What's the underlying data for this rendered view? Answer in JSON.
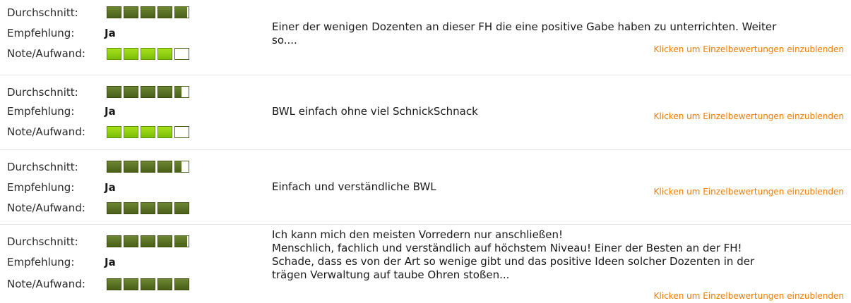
{
  "labels": {
    "durchschnitt": "Durchschnitt:",
    "empfehlung": "Empfehlung:",
    "note_aufwand": "Note/Aufwand:"
  },
  "toggle_link_text": "Klicken um Einzelbewertungen einzublenden",
  "colors": {
    "rating_dark": "#4a5f17",
    "rating_light": "#7cbf08",
    "link": "#f07c00"
  },
  "reviews": [
    {
      "durchschnitt_rating": 4.9,
      "empfehlung": "Ja",
      "note_aufwand_rating": 4,
      "comment_lines": [
        "Einer der wenigen Dozenten an dieser FH die eine positive Gabe haben zu unterrichten. Weiter",
        "so...."
      ]
    },
    {
      "durchschnitt_rating": 4.5,
      "empfehlung": "Ja",
      "note_aufwand_rating": 4,
      "comment_lines": [
        "BWL einfach ohne viel SchnickSchnack"
      ]
    },
    {
      "durchschnitt_rating": 4.5,
      "empfehlung": "Ja",
      "note_aufwand_rating": 5,
      "comment_lines": [
        "Einfach und verständliche BWL"
      ]
    },
    {
      "durchschnitt_rating": 4.9,
      "empfehlung": "Ja",
      "note_aufwand_rating": 5,
      "comment_lines": [
        "Ich kann mich den meisten Vorredern nur anschließen!",
        "Menschlich, fachlich und verständlich auf höchstem Niveau! Einer der Besten an der FH!",
        "Schade, dass es von der Art so wenige gibt und das positive Ideen solcher Dozenten in der",
        "trägen Verwaltung auf taube Ohren stoßen..."
      ]
    }
  ]
}
